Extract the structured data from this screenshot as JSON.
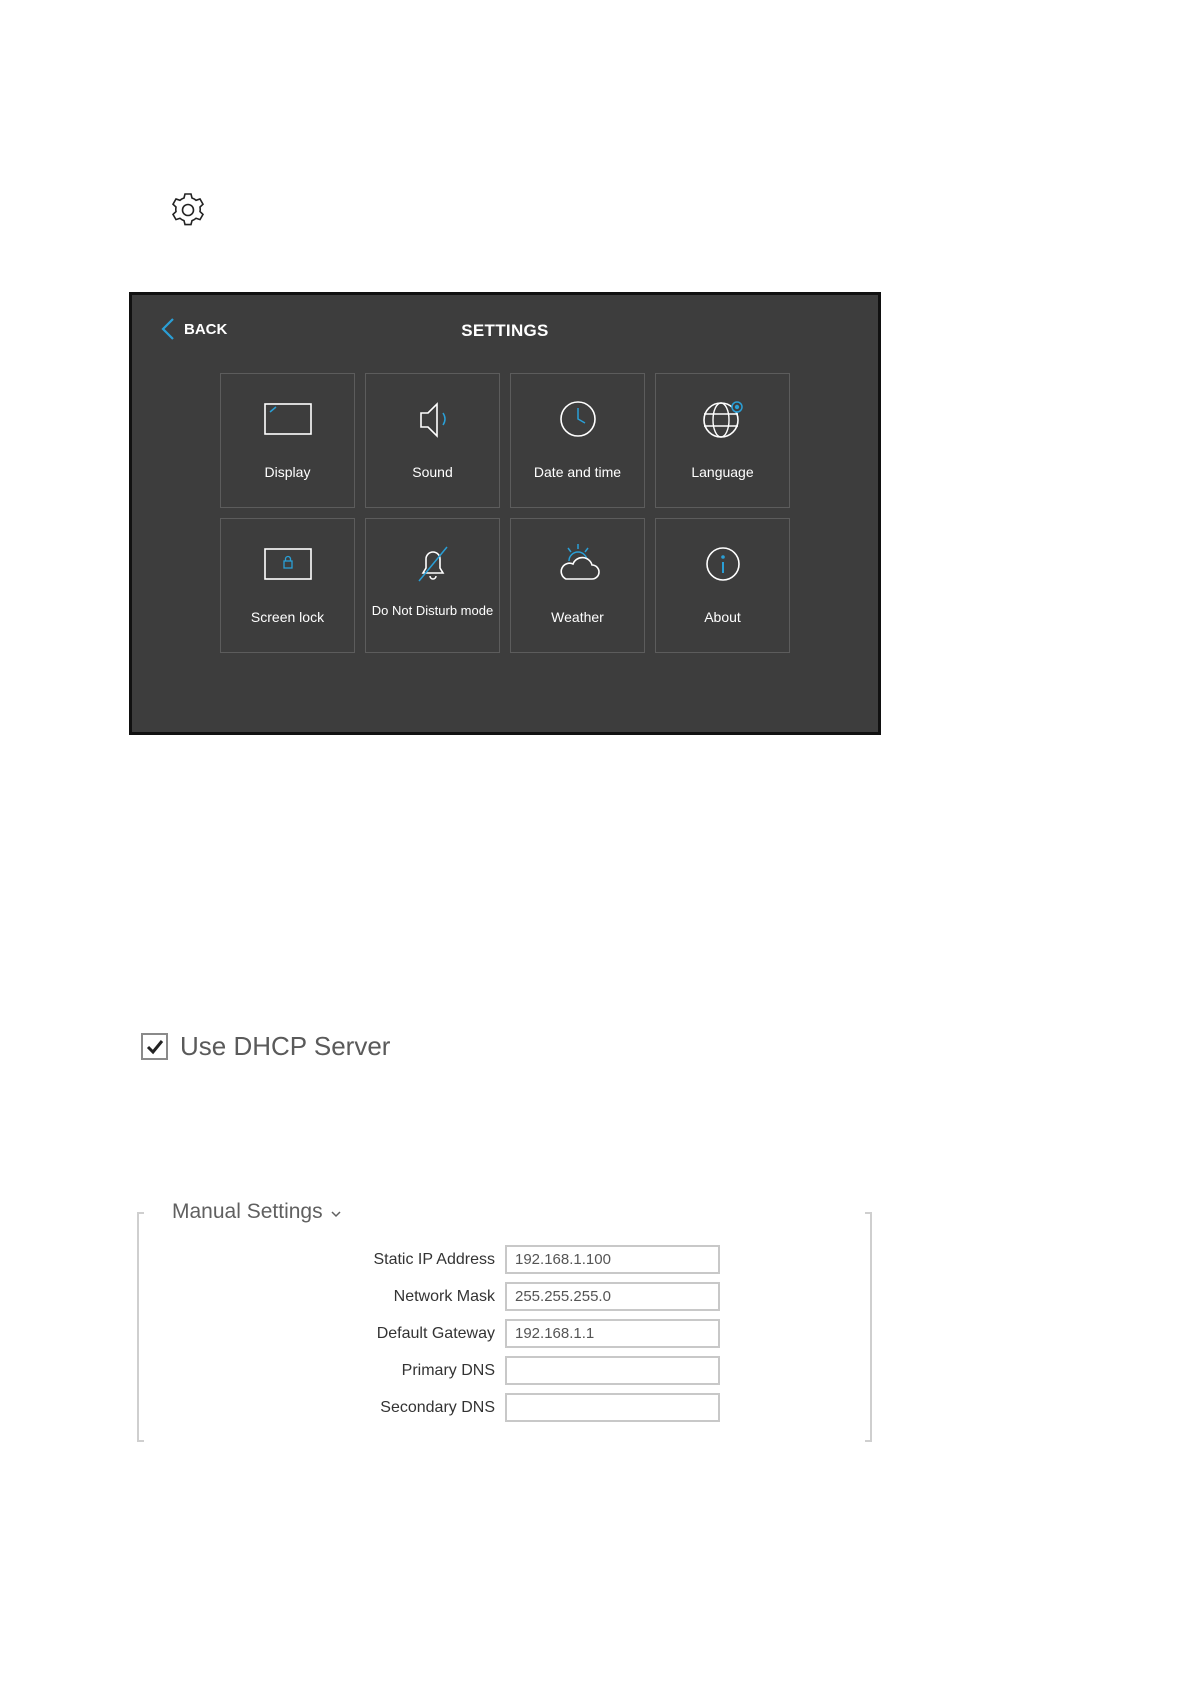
{
  "icons": {
    "top": "gear-icon"
  },
  "panel": {
    "back_label": "BACK",
    "title": "SETTINGS",
    "accent": "#2a9fd6",
    "tiles": [
      {
        "label": "Display",
        "icon": "display-icon"
      },
      {
        "label": "Sound",
        "icon": "speaker-icon"
      },
      {
        "label": "Date and time",
        "icon": "clock-icon"
      },
      {
        "label": "Language",
        "icon": "globe-icon"
      },
      {
        "label": "Screen lock",
        "icon": "lock-screen-icon"
      },
      {
        "label": "Do Not Disturb mode",
        "icon": "bell-off-icon"
      },
      {
        "label": "Weather",
        "icon": "weather-icon"
      },
      {
        "label": "About",
        "icon": "info-icon"
      }
    ]
  },
  "dhcp": {
    "label": "Use DHCP Server",
    "checked": true
  },
  "manual": {
    "title": "Manual Settings",
    "fields": [
      {
        "label": "Static IP Address",
        "value": "192.168.1.100"
      },
      {
        "label": "Network Mask",
        "value": "255.255.255.0"
      },
      {
        "label": "Default Gateway",
        "value": "192.168.1.1"
      },
      {
        "label": "Primary DNS",
        "value": ""
      },
      {
        "label": "Secondary DNS",
        "value": ""
      }
    ]
  }
}
